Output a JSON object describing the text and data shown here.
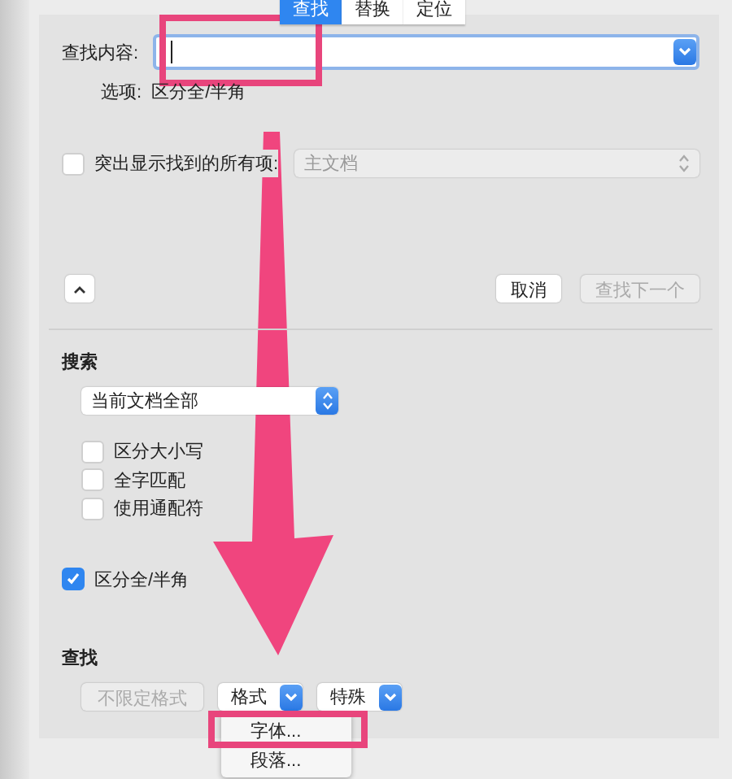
{
  "tabs": [
    {
      "label": "查找",
      "selected": true
    },
    {
      "label": "替换",
      "selected": false
    },
    {
      "label": "定位",
      "selected": false
    }
  ],
  "find_field": {
    "label": "查找内容:",
    "marked": true
  },
  "options": {
    "label": "选项:",
    "value": "区分全/半角"
  },
  "highlight": {
    "label": "突出显示找到的所有项:",
    "checked": false,
    "scope": "主文档",
    "disabled": true
  },
  "buttons": [
    {
      "label": "取消",
      "disabled": false
    },
    {
      "label": "查找下一个",
      "disabled": true
    }
  ],
  "search": {
    "heading": "搜索",
    "scope": "当前文档全部",
    "checkboxes": [
      {
        "label": "区分大小写",
        "checked": false
      },
      {
        "label": "全字匹配",
        "checked": false
      },
      {
        "label": "使用通配符",
        "checked": false
      }
    ],
    "width_option": {
      "label": "区分全/半角",
      "checked": true
    }
  },
  "format": {
    "heading": "查找",
    "buttons": [
      {
        "kind": "button",
        "label": "不限定格式",
        "disabled": true
      },
      {
        "kind": "popup",
        "label": "格式",
        "disabled": false
      },
      {
        "kind": "popup",
        "label": "特殊",
        "disabled": false
      }
    ],
    "menu": [
      {
        "label": "字体...",
        "marked": true
      },
      {
        "label": "段落...",
        "marked": false
      }
    ]
  }
}
